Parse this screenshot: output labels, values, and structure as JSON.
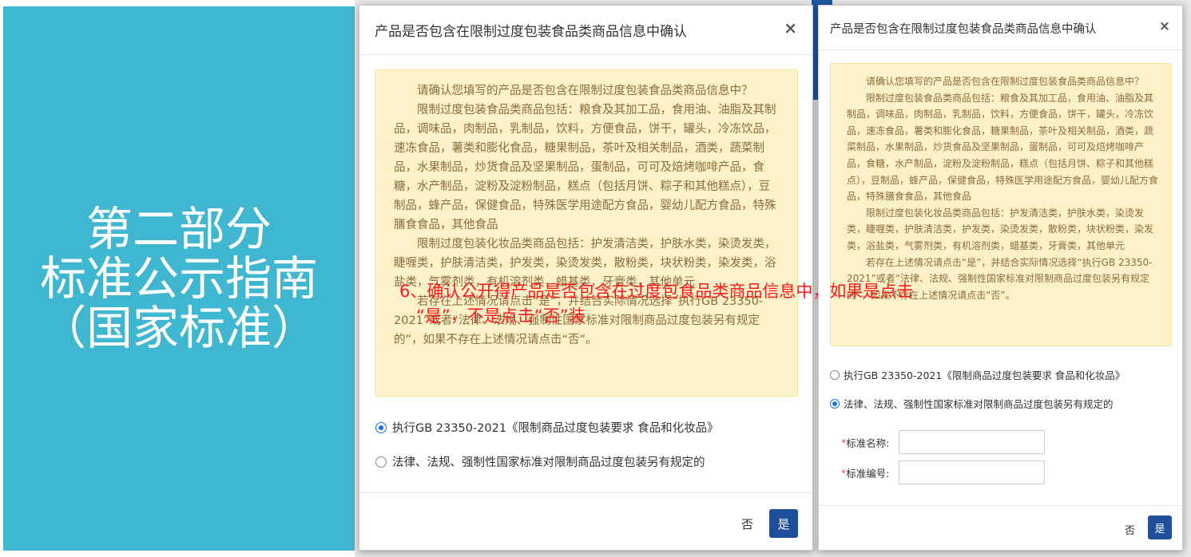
{
  "left_panel": {
    "color": "#40b7d0",
    "lines": [
      "第二部分",
      "标准公示指南",
      "（国家标准）"
    ]
  },
  "dialog1": {
    "title": "产品是否包含在限制过度包装食品类商品信息中确认",
    "close": "×",
    "notice": [
      "请确认您填写的产品是否包含在限制过度包装食品类商品信息中？",
      "限制过度包装食品类商品包括：粮食及其加工品，食用油、油脂及其制品，调味品，肉制品，乳制品，饮料，方便食品，饼干，罐头，冷冻饮品，速冻食品，薯类和膨化食品，糖果制品，茶叶及相关制品，酒类，蔬菜制品，水果制品，炒货食品及坚果制品，蛋制品，可可及焙烤咖啡产品，食糖，水产制品，淀粉及淀粉制品，糕点（包括月饼、粽子和其他糕点），豆制品，蜂产品，保健食品，特殊医学用途配方食品，婴幼儿配方食品，特殊膳食食品，其他食品",
      "限制过度包装化妆品类商品包括：护发清洁类，护肤水类，染烫发类，睫喱类，护肤清洁类，护发类，染烫发类，散粉类，块状粉类，染发类，浴盐类，气雾剂类，有机溶剂类，蜡基类，牙膏类，其他单元",
      "若存在上述情况请点击“是”，并结合实际情况选择“执行GB 23350-2021”或者“法律、法规、强制性国家标准对限制商品过度包装另有规定的”，如果不存在上述情况请点击“否”。"
    ],
    "option1": "执行GB 23350-2021《限制商品过度包装要求 食品和化妆品》",
    "option2": "法律、法规、强制性国家标准对限制商品过度包装另有规定的",
    "selected": 1,
    "no_label": "否",
    "yes_label": "是"
  },
  "dialog2": {
    "title": "产品是否包含在限制过度包装食品类商品信息中确认",
    "close": "×",
    "notice": [
      "请确认您填写的产品是否包含在限制过度包装食品类商品信息中？",
      "限制过度包装食品类商品包括：粮食及其加工品，食用油、油脂及其制品，调味品，肉制品，乳制品，饮料，方便食品，饼干，罐头，冷冻饮品，速冻食品，薯类和膨化食品，糖果制品，茶叶及相关制品，酒类，蔬菜制品，水果制品，炒货食品及坚果制品，蛋制品，可可及焙烤咖啡产品，食糖，水产制品，淀粉及淀粉制品，糕点（包括月饼、粽子和其他糕点），豆制品，蜂产品，保健食品，特殊医学用途配方食品，婴幼儿配方食品，特殊膳食食品，其他食品",
      "限制过度包装化妆品类商品包括：护发清洁类，护肤水类，染烫发类，睫喱类，护肤清洁类，护发类，染烫发类，散粉类，块状粉类，染发类，浴盐类，气雾剂类，有机溶剂类，蜡基类，牙膏类，其他单元",
      "若存在上述情况请点击“是”，并结合实际情况选择“执行GB 23350-2021”或者“法律、法规、强制性国家标准对限制商品过度包装另有规定的”，如果不存在上述情况请点击“否”。"
    ],
    "option1": "执行GB 23350-2021《限制商品过度包装要求 食品和化妆品》",
    "option2": "法律、法规、强制性国家标准对限制商品过度包装另有规定的",
    "selected": 2,
    "form": {
      "required_mark": "*",
      "name_label": "标准名称:",
      "name_value": "",
      "number_label": "标准编号:",
      "number_value": ""
    },
    "no_label": "否",
    "yes_label": "是"
  },
  "annotation": {
    "line1": "6、确认公开得产品是否包含在过度包食品类商品信息中，如果是点击",
    "line2": "“是”，不是点击“否”装",
    "color": "#ff1a1a"
  }
}
